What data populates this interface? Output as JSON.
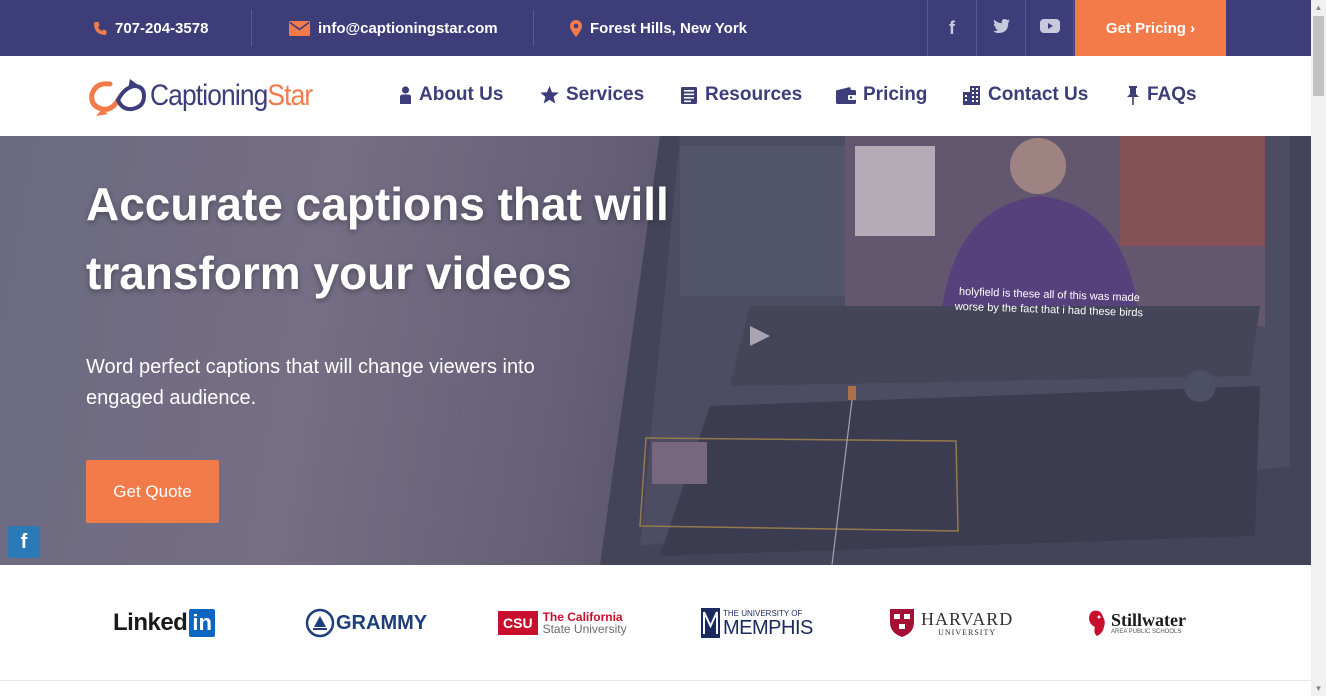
{
  "topbar": {
    "phone": "707-204-3578",
    "email": "info@captioningstar.com",
    "location": "Forest Hills, New York",
    "get_pricing": "Get Pricing ›"
  },
  "nav": {
    "logo_left": "Captioning",
    "logo_right": "Star",
    "items": [
      {
        "label": "About Us"
      },
      {
        "label": "Services"
      },
      {
        "label": "Resources"
      },
      {
        "label": "Pricing"
      },
      {
        "label": "Contact Us"
      },
      {
        "label": "FAQs"
      }
    ]
  },
  "hero": {
    "title": "Accurate captions that will transform your videos",
    "subtitle": "Word perfect captions that will change viewers into engaged audience.",
    "cta": "Get Quote",
    "video_caption_line1": "holyfield is these all of this was made",
    "video_caption_line2": "worse by the fact that i had these birds"
  },
  "clients": {
    "linkedin": "Linked",
    "linkedin_in": "in",
    "grammy": "GRAMMY",
    "csu_badge": "CSU",
    "csu_line1": "The California",
    "csu_line2": "State University",
    "memphis_line1": "THE UNIVERSITY OF",
    "memphis_line2": "MEMPHIS",
    "harvard_line1": "HARVARD",
    "harvard_line2": "UNIVERSITY",
    "stillwater_line1": "Stillwater",
    "stillwater_line2": "AREA PUBLIC SCHOOLS"
  },
  "colors": {
    "brand_navy": "#3d3d7a",
    "accent_orange": "#f37b4a"
  }
}
